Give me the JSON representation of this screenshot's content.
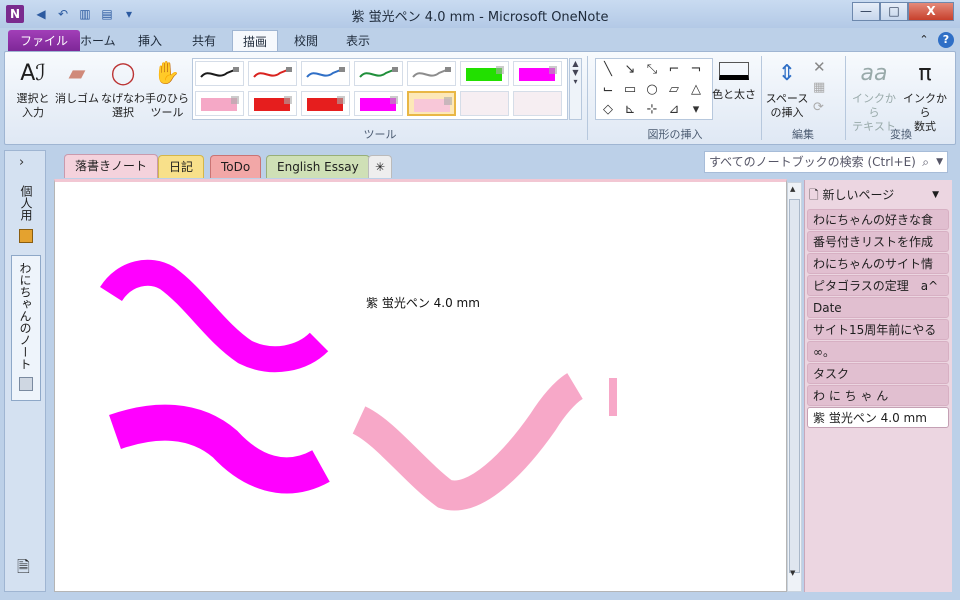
{
  "window": {
    "app_icon_letter": "N",
    "title": "紫 蛍光ペン 4.0 mm  -  Microsoft OneNote",
    "controls": {
      "minimize": "—",
      "maximize": "□",
      "close": "X"
    }
  },
  "ribbon_tabs": [
    {
      "label": "ファイル"
    },
    {
      "label": "ホーム"
    },
    {
      "label": "挿入"
    },
    {
      "label": "共有"
    },
    {
      "label": "描画"
    },
    {
      "label": "校閲"
    },
    {
      "label": "表示"
    }
  ],
  "tools": {
    "select_lasso": "選択と\n入力",
    "eraser": "消しゴム",
    "lasso": "なげなわ\n選択",
    "panning": "手のひら\nツール",
    "group_label": "ツール"
  },
  "pens": [
    {
      "color": "#1a1a1a",
      "type": "pen"
    },
    {
      "color": "#d9231f",
      "type": "pen"
    },
    {
      "color": "#2f6fc6",
      "type": "pen"
    },
    {
      "color": "#1f8f3a",
      "type": "pen"
    },
    {
      "color": "#8c8c8c",
      "type": "pen"
    },
    {
      "color": "#22e000",
      "type": "highlighter"
    },
    {
      "color": "#ff00ff",
      "type": "highlighter"
    },
    {
      "color": "#f5a8c6",
      "type": "highlighter"
    },
    {
      "color": "#e61e1e",
      "type": "highlighter"
    },
    {
      "color": "#e61e1e",
      "type": "highlighter"
    },
    {
      "color": "#ff00ff",
      "type": "highlighter"
    },
    {
      "color": "#f8c7d8",
      "type": "highlighter",
      "selected": true
    },
    {
      "color": "#f6eef2",
      "type": "empty"
    },
    {
      "color": "#f6eef2",
      "type": "empty"
    }
  ],
  "shapes": {
    "group_label": "図形の挿入",
    "color_width": "色と太さ"
  },
  "edit": {
    "insert_space": "スペース\nの挿入",
    "group_label": "編集"
  },
  "convert": {
    "ink_to_text": "インクから\nテキスト",
    "ink_to_math": "インクから\n数式",
    "group_label": "変換"
  },
  "notebooks": {
    "personal": "個人用",
    "current": "わにちゃんのノート"
  },
  "section_tabs": [
    {
      "label": "落書きノート",
      "color": "#f4d2dc",
      "active": true
    },
    {
      "label": "日記",
      "color": "#f8e08a"
    },
    {
      "label": "ToDo",
      "color": "#f2a7a7"
    },
    {
      "label": "English Essay",
      "color": "#cfe0b6"
    },
    {
      "label": "✳",
      "color": "#eeeeee"
    }
  ],
  "search": {
    "placeholder": "すべてのノートブックの検索 (Ctrl+E)"
  },
  "page_panel": {
    "new_page": "新しいページ",
    "pages": [
      "わにちゃんの好きな食",
      "番号付きリストを作成",
      "わにちゃんのサイト情",
      "ピタゴラスの定理　a^",
      "Date",
      "サイト15周年前にやる",
      "∞。",
      "タスク",
      "わ に ち ゃ ん",
      "紫 蛍光ペン 4.0 mm"
    ],
    "selected_index": 9
  },
  "page": {
    "text": "紫 蛍光ペン 4.0 mm",
    "strokes": [
      {
        "color": "#ff00ff",
        "shape": "tilde-top"
      },
      {
        "color": "#ff00ff",
        "shape": "tilde-bottom"
      },
      {
        "color": "#f7a8c8",
        "shape": "check"
      }
    ]
  }
}
